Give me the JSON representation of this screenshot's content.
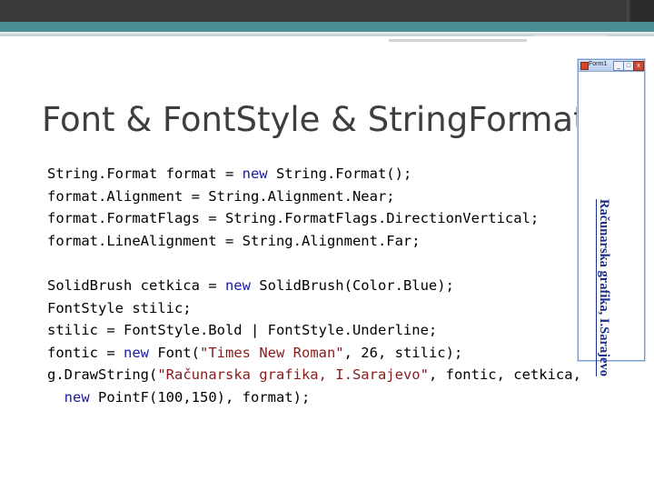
{
  "slide": {
    "title": "Font & FontStyle & StringFormat"
  },
  "code_block_1": {
    "lines": [
      [
        {
          "t": "String.Format format = ",
          "c": "pl"
        },
        {
          "t": "new",
          "c": "kw"
        },
        {
          "t": " String.Format();",
          "c": "pl"
        }
      ],
      [
        {
          "t": "format.Alignment = String.Alignment.Near;",
          "c": "pl"
        }
      ],
      [
        {
          "t": "format.FormatFlags = String.FormatFlags.DirectionVertical;",
          "c": "pl"
        }
      ],
      [
        {
          "t": "format.LineAlignment = String.Alignment.Far;",
          "c": "pl"
        }
      ]
    ]
  },
  "code_block_2": {
    "lines": [
      [
        {
          "t": "SolidBrush cetkica = ",
          "c": "pl"
        },
        {
          "t": "new",
          "c": "kw"
        },
        {
          "t": " SolidBrush(Color.Blue);",
          "c": "pl"
        }
      ],
      [
        {
          "t": "FontStyle stilic;",
          "c": "pl"
        }
      ],
      [
        {
          "t": "stilic = FontStyle.Bold | FontStyle.Underline;",
          "c": "pl"
        }
      ],
      [
        {
          "t": "fontic = ",
          "c": "pl"
        },
        {
          "t": "new",
          "c": "kw"
        },
        {
          "t": " Font(",
          "c": "pl"
        },
        {
          "t": "\"Times New Roman\"",
          "c": "str"
        },
        {
          "t": ", 26, stilic);",
          "c": "pl"
        }
      ],
      [
        {
          "t": "g.DrawString(",
          "c": "pl"
        },
        {
          "t": "\"Računarska grafika, I.Sarajevo\"",
          "c": "str"
        },
        {
          "t": ", fontic, cetkica,",
          "c": "pl"
        }
      ],
      [
        {
          "t": "  ",
          "c": "pl"
        },
        {
          "t": "new",
          "c": "kw"
        },
        {
          "t": " PointF(100,150), format);",
          "c": "pl"
        }
      ]
    ]
  },
  "window": {
    "title": "Form1",
    "minimize_symbol": "_",
    "maximize_symbol": "□",
    "close_symbol": "x",
    "vertical_text": "Računarska grafika, I.Sarajevo"
  },
  "colors": {
    "keyword": "#1a1aa6",
    "string": "#8b1a1a",
    "header_teal": "#4c8d93",
    "vertical_text": "#1a2d8c"
  }
}
